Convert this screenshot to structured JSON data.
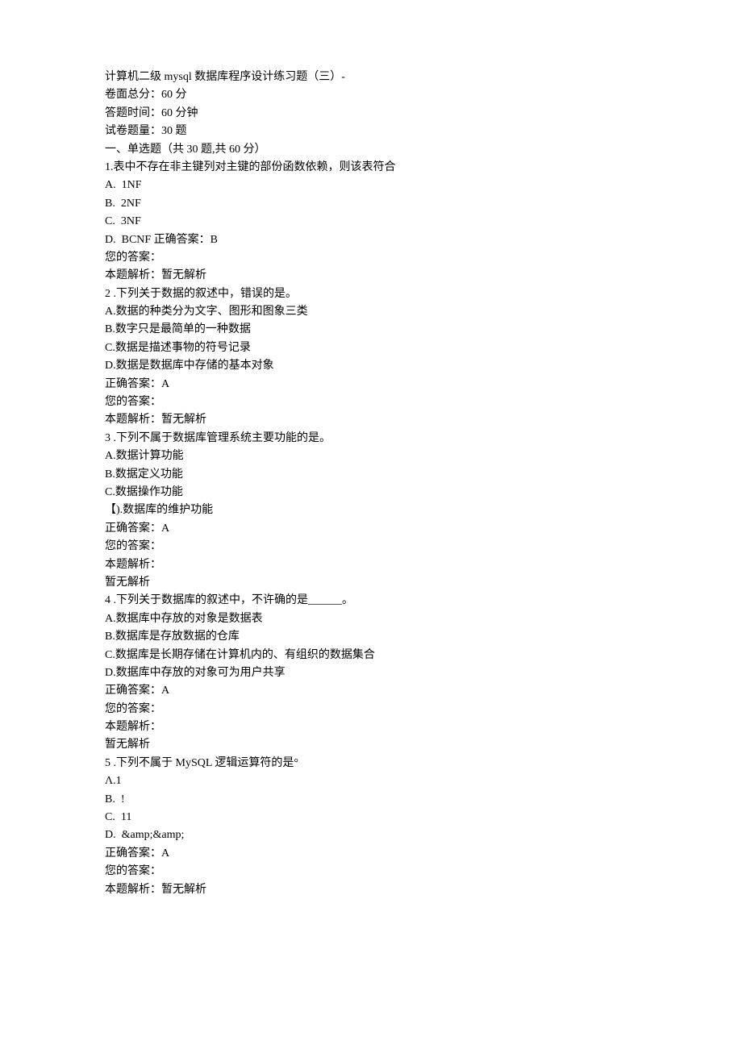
{
  "header": {
    "title": "计算机二级 mysql 数据库程序设计练习题（三）-",
    "total_score_label": "卷面总分：60 分",
    "time_label": "答题时间：60 分钟",
    "count_label": "试卷题量：30 题",
    "section_label": "一、单选题（共 30 题,共 60 分）"
  },
  "q1": {
    "stem": "1.表中不存在非主键列对主键的部份函数依赖，则该表符合",
    "optA": "A.  1NF",
    "optB": "B.  2NF",
    "optC": "C.  3NF",
    "optD": "D.  BCNF 正确答案：B",
    "your_answer": "您的答案：",
    "analysis": "本题解析：暂无解析"
  },
  "q2": {
    "stem": "2 .下列关于数据的叙述中，错误的是。",
    "optA": "A.数据的种类分为文字、图形和图象三类",
    "optB": "B.数字只是最简单的一种数据",
    "optC": "C.数据是描述事物的符号记录",
    "optD": "D.数据是数据库中存储的基本对象",
    "correct": "正确答案：A",
    "your_answer": "您的答案：",
    "analysis": "本题解析：暂无解析"
  },
  "q3": {
    "stem": "3 .下列不属于数据库管理系统主要功能的是。",
    "optA": "A.数据计算功能",
    "optB": "B.数据定义功能",
    "optC": "C.数据操作功能",
    "optD": "【).数据库的维护功能",
    "correct": "正确答案：A",
    "your_answer": "您的答案：",
    "analysis_label": "本题解析：",
    "analysis_text": "暂无解析"
  },
  "q4": {
    "stem": "4 .下列关于数据库的叙述中，不许确的是______。",
    "optA": "A.数据库中存放的对象是数据表",
    "optB": "B.数据库是存放数据的仓库",
    "optC": "C.数据库是长期存储在计算机内的、有组织的数据集合",
    "optD": "D.数据库中存放的对象可为用户共享",
    "correct": "正确答案：A",
    "your_answer": "您的答案：",
    "analysis_label": "本题解析：",
    "analysis_text": "暂无解析"
  },
  "q5": {
    "stem": "5 .下列不属于 MySQL 逻辑运算符的是°",
    "optA": "Λ.1",
    "optB": "B.  !",
    "optC": "C.  11",
    "optD": "D.  &amp;&amp;",
    "correct": "正确答案：A",
    "your_answer": "您的答案：",
    "analysis": "本题解析：暂无解析"
  }
}
